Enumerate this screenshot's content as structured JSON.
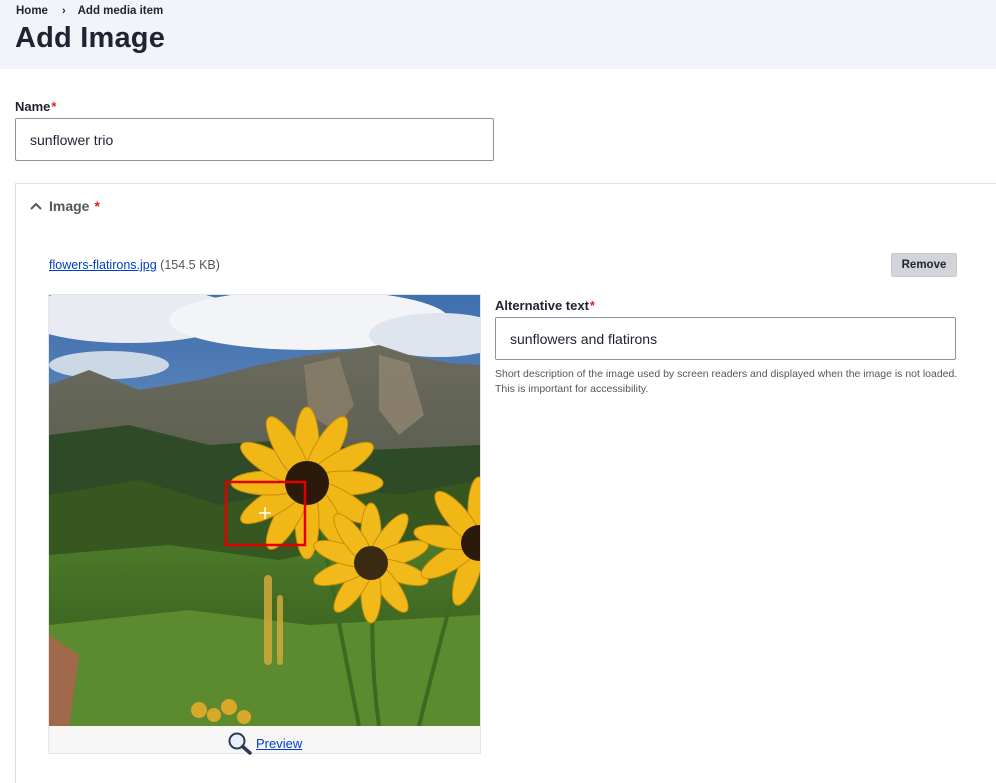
{
  "breadcrumb": {
    "home": "Home",
    "separator": "›",
    "current": "Add media item"
  },
  "page": {
    "title": "Add Image"
  },
  "name_field": {
    "label": "Name",
    "required_mark": "*",
    "value": "sunflower trio"
  },
  "image_section": {
    "summary_label": "Image",
    "required_mark": "*",
    "file_name": "flowers-flatirons.jpg",
    "file_size": "(154.5 KB)",
    "remove_label": "Remove",
    "preview_label": "Preview",
    "alt_text": {
      "label": "Alternative text",
      "required_mark": "*",
      "value": "sunflowers and flatirons",
      "description": "Short description of the image used by screen readers and displayed when the image is not loaded. This is important for accessibility."
    }
  },
  "colors": {
    "link": "#003ecc",
    "required": "#dc2323",
    "focal_marker": "#e00000"
  },
  "icons": {
    "collapse": "chevron-up-icon",
    "preview": "magnifier-icon",
    "focal": "crosshair-icon"
  }
}
